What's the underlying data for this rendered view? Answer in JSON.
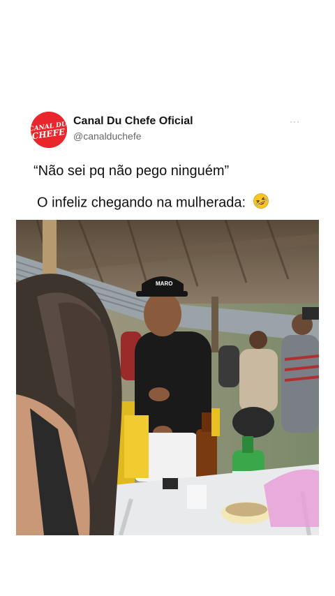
{
  "post": {
    "account_name": "Canal Du Chefe Oficial",
    "account_handle": "@canalduchefe",
    "more_label": "···",
    "avatar_text_line1": "CANAL DU",
    "avatar_text_line2": "CHEFE",
    "caption_line1": "“Não sei pq não pego ninguém”",
    "caption_line2": "O infeliz chegando na mulherada:",
    "caption_emoji": "rolling-on-floor-laughing-icon"
  },
  "video": {
    "cap_text": "MARO"
  },
  "colors": {
    "brand_red": "#e8262b",
    "handle_gray": "#666666"
  }
}
